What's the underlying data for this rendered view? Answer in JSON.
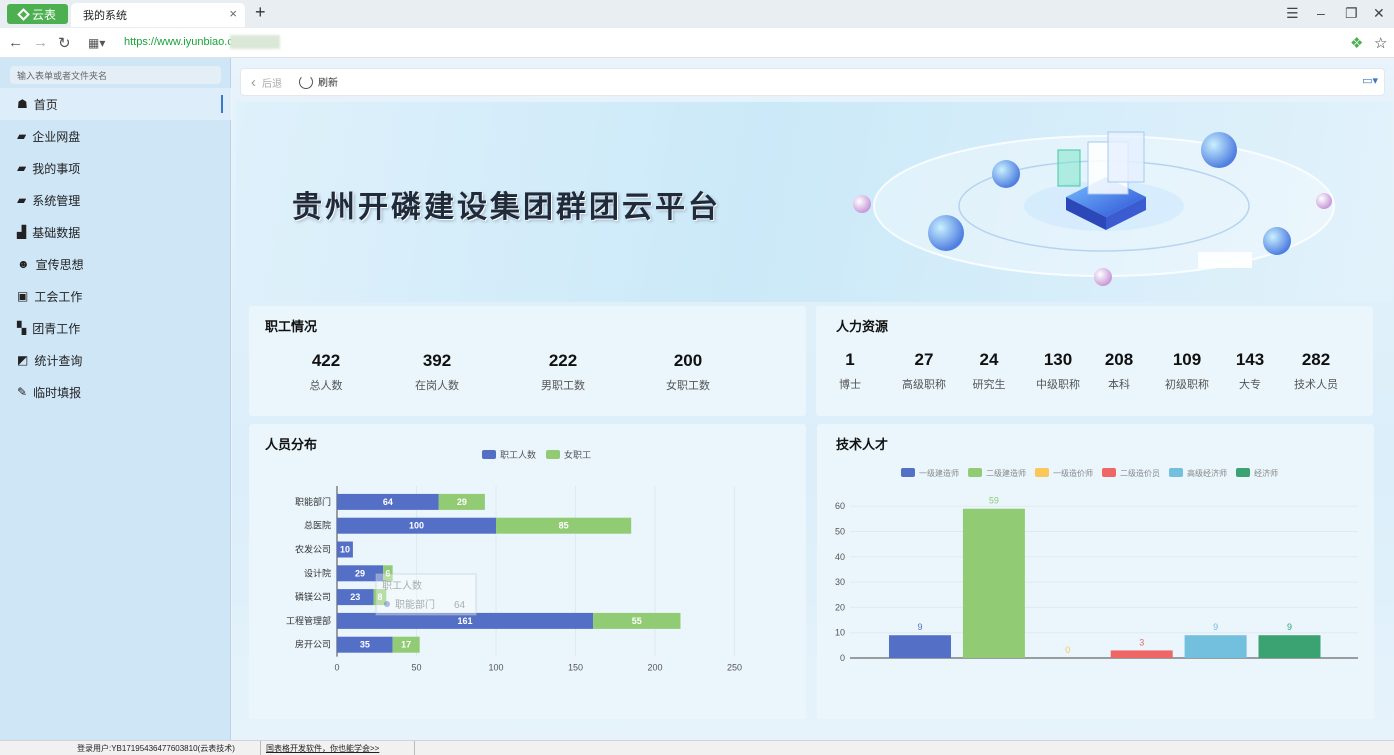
{
  "browser": {
    "brand_label": "云表",
    "tab_title": "我的系统",
    "tab_close": "×",
    "new_tab": "+",
    "url": "https://www.iyunbiao.cn"
  },
  "sidebar": {
    "search_placeholder": "输入表单或者文件夹名",
    "items": [
      {
        "label": "首页",
        "icon": "home-icon"
      },
      {
        "label": "企业网盘",
        "icon": "folder-icon"
      },
      {
        "label": "我的事项",
        "icon": "folder-icon"
      },
      {
        "label": "系统管理",
        "icon": "folder-icon"
      },
      {
        "label": "基础数据",
        "icon": "bar-chart-icon"
      },
      {
        "label": "宣传思想",
        "icon": "people-icon"
      },
      {
        "label": "工会工作",
        "icon": "id-card-icon"
      },
      {
        "label": "团青工作",
        "icon": "grid-icon"
      },
      {
        "label": "统计查询",
        "icon": "chart-icon"
      },
      {
        "label": "临时填报",
        "icon": "edit-icon"
      }
    ]
  },
  "toolbar": {
    "back_label": "后退",
    "refresh_label": "刷新"
  },
  "banner": {
    "title": "贵州开磷建设集团群团云平台"
  },
  "employees": {
    "title": "职工情况",
    "stats": [
      {
        "value": "422",
        "label": "总人数"
      },
      {
        "value": "392",
        "label": "在岗人数"
      },
      {
        "value": "222",
        "label": "男职工数"
      },
      {
        "value": "200",
        "label": "女职工数"
      }
    ]
  },
  "hr": {
    "title": "人力资源",
    "stats": [
      {
        "value": "1",
        "label": "博士"
      },
      {
        "value": "27",
        "label": "高级职称"
      },
      {
        "value": "24",
        "label": "研究生"
      },
      {
        "value": "130",
        "label": "中级职称"
      },
      {
        "value": "208",
        "label": "本科"
      },
      {
        "value": "109",
        "label": "初级职称"
      },
      {
        "value": "143",
        "label": "大专"
      },
      {
        "value": "282",
        "label": "技术人员"
      }
    ]
  },
  "distribution": {
    "title": "人员分布"
  },
  "talent": {
    "title": "技术人才"
  },
  "tooltip": {
    "title": "职工人数",
    "item": "职能部门",
    "value": "64"
  },
  "colors": {
    "blue": "#5470c6",
    "green": "#91cc75",
    "yellow": "#fac858",
    "red": "#ee6666",
    "cyan": "#73c0de",
    "teal": "#3ba272"
  },
  "chart_data": [
    {
      "type": "bar",
      "orientation": "horizontal",
      "stacked": true,
      "categories": [
        "职能部门",
        "总医院",
        "农发公司",
        "设计院",
        "磷镁公司",
        "工程管理部",
        "房开公司"
      ],
      "series": [
        {
          "name": "职工人数",
          "values": [
            64,
            100,
            10,
            29,
            23,
            161,
            35
          ]
        },
        {
          "name": "女职工",
          "values": [
            29,
            85,
            null,
            6,
            8,
            55,
            17
          ]
        }
      ],
      "x_ticks": [
        0,
        50,
        100,
        150,
        200,
        250
      ],
      "xlim": [
        0,
        250
      ],
      "legend": "top-center",
      "grid": true
    },
    {
      "type": "bar",
      "categories": [
        "一级建造师",
        "二级建造师",
        "一级造价师",
        "二级造价员",
        "高级经济师",
        "经济师"
      ],
      "series": [
        {
          "name": "一级建造师",
          "value": 9
        },
        {
          "name": "二级建造师",
          "value": 59
        },
        {
          "name": "一级造价师",
          "value": 0
        },
        {
          "name": "二级造价员",
          "value": 3
        },
        {
          "name": "高级经济师",
          "value": 9
        },
        {
          "name": "经济师",
          "value": 9
        }
      ],
      "y_ticks": [
        0,
        10,
        20,
        30,
        40,
        50,
        60
      ],
      "ylim": [
        0,
        60
      ],
      "legend": "top-center",
      "grid": true
    }
  ],
  "statusbar": {
    "user": "登录用户:YB17195436477603810(云表技术)",
    "promo": "国表格开发软件，你也能学会>>"
  }
}
